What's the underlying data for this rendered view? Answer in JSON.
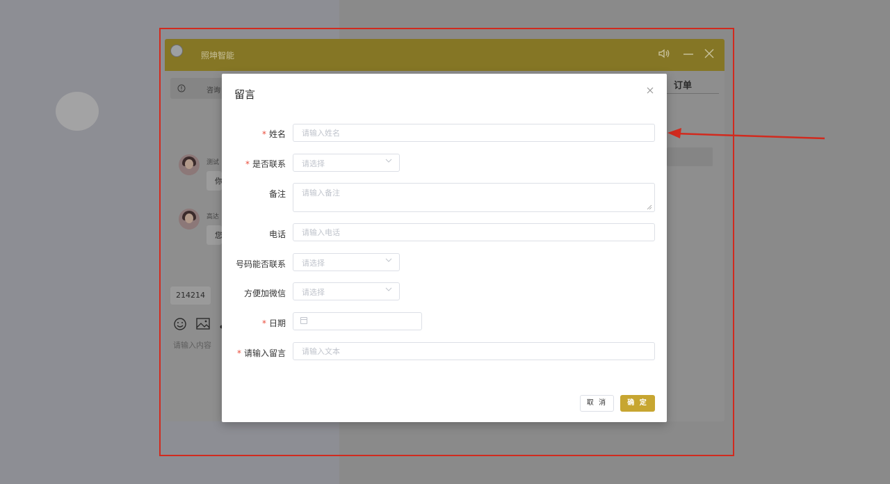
{
  "chat": {
    "title": "照坤智能",
    "notice_text": "咨询",
    "order_tab": "订单",
    "messages": [
      {
        "name": "测试",
        "text": "你"
      },
      {
        "name": "高达",
        "text": "您"
      }
    ],
    "quick_reply": "214214",
    "input_placeholder": "请输入内容",
    "colors": {
      "header": "#857625",
      "accent": "#c7a631"
    }
  },
  "modal": {
    "title": "留言",
    "required_mark": "*",
    "fields": {
      "name": {
        "label": "姓名",
        "placeholder": "请输入姓名",
        "required": true
      },
      "contact": {
        "label": "是否联系",
        "placeholder": "请选择",
        "required": true
      },
      "note": {
        "label": "备注",
        "placeholder": "请输入备注",
        "required": false
      },
      "phone": {
        "label": "电话",
        "placeholder": "请输入电话",
        "required": false
      },
      "phone_reachable": {
        "label": "号码能否联系",
        "placeholder": "请选择",
        "required": false
      },
      "wechat": {
        "label": "方便加微信",
        "placeholder": "请选择",
        "required": false
      },
      "date": {
        "label": "日期",
        "placeholder": "",
        "required": true
      },
      "message": {
        "label": "请输入留言",
        "placeholder": "请输入文本",
        "required": true
      }
    },
    "buttons": {
      "cancel": "取 消",
      "confirm": "确 定"
    }
  }
}
